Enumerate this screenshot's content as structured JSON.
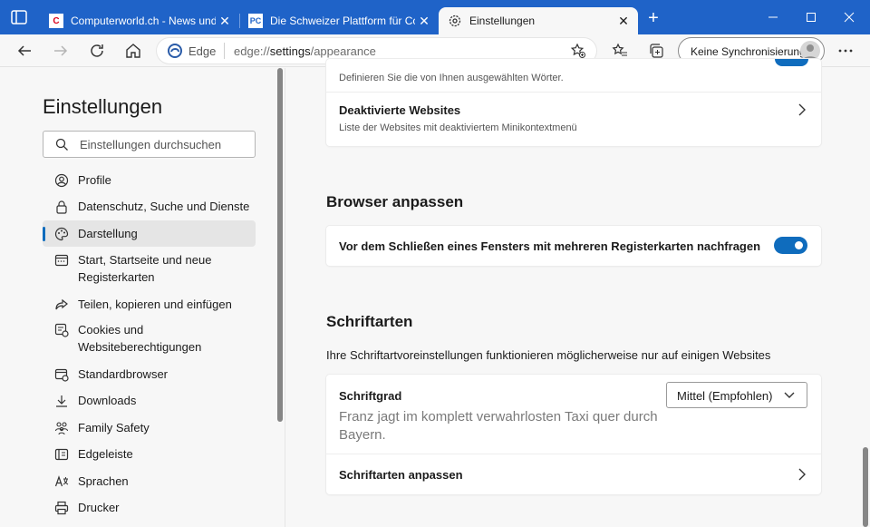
{
  "tabs": [
    {
      "title": "Computerworld.ch - News und Analysen",
      "favicon": "C",
      "active": false
    },
    {
      "title": "Die Schweizer Plattform für Computer",
      "favicon": "PC",
      "active": false
    },
    {
      "title": "Einstellungen",
      "favicon": "gear-icon",
      "active": true
    }
  ],
  "toolbar": {
    "edge_label": "Edge",
    "url_prefix": "edge://",
    "url_highlight": "settings",
    "url_suffix": "/appearance",
    "sync_label": "Keine Synchronisierung"
  },
  "sidebar": {
    "title": "Einstellungen",
    "search_placeholder": "Einstellungen durchsuchen",
    "items": [
      {
        "label": "Profile"
      },
      {
        "label": "Datenschutz, Suche und Dienste"
      },
      {
        "label": "Darstellung",
        "selected": true
      },
      {
        "label": "Start, Startseite und neue Registerkarten"
      },
      {
        "label": "Teilen, kopieren und einfügen"
      },
      {
        "label": "Cookies und Websiteberechtigungen"
      },
      {
        "label": "Standardbrowser"
      },
      {
        "label": "Downloads"
      },
      {
        "label": "Family Safety"
      },
      {
        "label": "Edgeleiste"
      },
      {
        "label": "Sprachen"
      },
      {
        "label": "Drucker"
      }
    ]
  },
  "main": {
    "top_card": {
      "partial_sub": "Definieren Sie die von Ihnen ausgewählten Wörter.",
      "row_title": "Deaktivierte Websites",
      "row_sub": "Liste der Websites mit deaktiviertem Minikontextmenü"
    },
    "browser_section": {
      "title": "Browser anpassen",
      "toggle_label": "Vor dem Schließen eines Fensters mit mehreren Registerkarten nachfragen",
      "toggle_on": true
    },
    "fonts_section": {
      "title": "Schriftarten",
      "description": "Ihre Schriftartvoreinstellungen funktionieren möglicherweise nur auf einigen Websites",
      "size_label": "Schriftgrad",
      "size_value": "Mittel (Empfohlen)",
      "preview_text": "Franz jagt im komplett verwahrlosten Taxi quer durch Bayern.",
      "customize_label": "Schriftarten anpassen"
    }
  },
  "colors": {
    "titlebar": "#1f63c8",
    "accent": "#0f6cbd"
  }
}
